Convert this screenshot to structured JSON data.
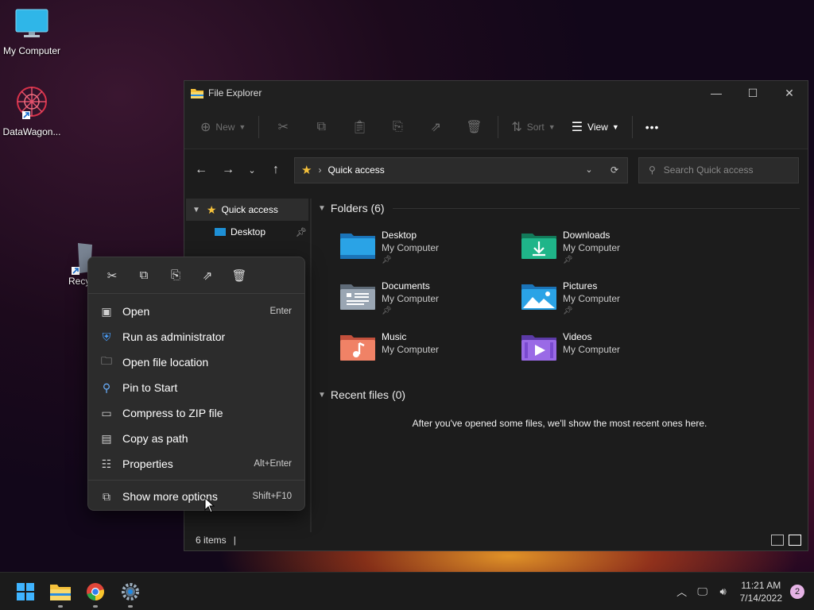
{
  "desktop": {
    "icons": [
      {
        "label": "My Computer",
        "icon": "monitor-icon"
      },
      {
        "label": "DataWagon...",
        "icon": "datawagon-icon"
      },
      {
        "label": "Recy",
        "icon": "recycle-bin-icon"
      }
    ]
  },
  "explorer": {
    "title": "File Explorer",
    "window_controls": {
      "minimize": "—",
      "maximize": "☐",
      "close": "✕"
    },
    "toolbar": {
      "new_label": "New",
      "sort_label": "Sort",
      "view_label": "View",
      "more_label": "•••"
    },
    "address": {
      "location": "Quick access",
      "search_placeholder": "Search Quick access"
    },
    "sidebar": {
      "items": [
        {
          "label": "Quick access"
        },
        {
          "label": "Desktop"
        }
      ]
    },
    "folders_header": "Folders (6)",
    "folders": [
      {
        "name": "Desktop",
        "location": "My Computer",
        "pinned": true,
        "color": "#1e90d6"
      },
      {
        "name": "Downloads",
        "location": "My Computer",
        "pinned": true,
        "color": "#1ca27a"
      },
      {
        "name": "Documents",
        "location": "My Computer",
        "pinned": true,
        "color": "#7f8c9b"
      },
      {
        "name": "Pictures",
        "location": "My Computer",
        "pinned": true,
        "color": "#1e90d6"
      },
      {
        "name": "Music",
        "location": "My Computer",
        "pinned": false,
        "color": "#e8705a"
      },
      {
        "name": "Videos",
        "location": "My Computer",
        "pinned": false,
        "color": "#8b5bd6"
      }
    ],
    "recent_header": "Recent files (0)",
    "recent_empty_message": "After you've opened some files, we'll show the most recent ones here.",
    "status": {
      "items": "6 items",
      "cursor": "|"
    }
  },
  "context_menu": {
    "quick_actions": [
      "cut-icon",
      "copy-icon",
      "rename-icon",
      "share-icon",
      "delete-icon"
    ],
    "items": [
      {
        "label": "Open",
        "shortcut": "Enter",
        "icon": "open-icon"
      },
      {
        "label": "Run as administrator",
        "shortcut": "",
        "icon": "shield-icon"
      },
      {
        "label": "Open file location",
        "shortcut": "",
        "icon": "folder-icon"
      },
      {
        "label": "Pin to Start",
        "shortcut": "",
        "icon": "pin-icon"
      },
      {
        "label": "Compress to ZIP file",
        "shortcut": "",
        "icon": "zip-icon"
      },
      {
        "label": "Copy as path",
        "shortcut": "",
        "icon": "path-icon"
      },
      {
        "label": "Properties",
        "shortcut": "Alt+Enter",
        "icon": "properties-icon"
      }
    ],
    "more": {
      "label": "Show more options",
      "shortcut": "Shift+F10"
    }
  },
  "taskbar": {
    "apps": [
      "start-icon",
      "file-explorer-icon",
      "chrome-icon",
      "settings-icon"
    ],
    "clock": {
      "time": "11:21 AM",
      "date": "7/14/2022"
    },
    "notifications": "2"
  }
}
